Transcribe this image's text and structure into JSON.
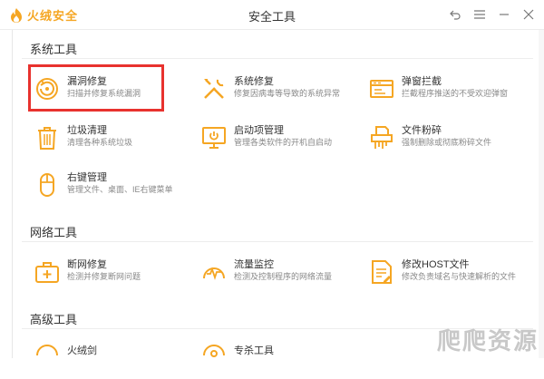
{
  "app": {
    "brand": "火绒安全",
    "window_title": "安全工具",
    "accent": "#f5a623",
    "highlight_color": "#e8322e"
  },
  "window_controls": {
    "back_icon": "back-arrow-icon",
    "menu_icon": "hamburger-menu-icon",
    "minimize_icon": "minimize-icon",
    "close_icon": "close-icon"
  },
  "sections": [
    {
      "title": "系统工具",
      "tools": [
        {
          "name": "漏洞修复",
          "desc": "扫描并修复系统漏洞",
          "icon": "vulnerability-fix-icon"
        },
        {
          "name": "系统修复",
          "desc": "修复因病毒等导致的系统异常",
          "icon": "system-repair-tools-icon"
        },
        {
          "name": "弹窗拦截",
          "desc": "拦截程序推送的不受欢迎弹窗",
          "icon": "popup-window-icon"
        },
        {
          "name": "垃圾清理",
          "desc": "清理各种系统垃圾",
          "icon": "trash-bin-icon"
        },
        {
          "name": "启动项管理",
          "desc": "管理各类软件的开机自启动",
          "icon": "startup-monitor-icon"
        },
        {
          "name": "文件粉碎",
          "desc": "强制删除或彻底粉碎文件",
          "icon": "file-shredder-icon"
        },
        {
          "name": "右键管理",
          "desc": "管理文件、桌面、IE右键菜单",
          "icon": "mouse-icon"
        }
      ]
    },
    {
      "title": "网络工具",
      "tools": [
        {
          "name": "断网修复",
          "desc": "检测并修复断网问题",
          "icon": "network-repair-kit-icon"
        },
        {
          "name": "流量监控",
          "desc": "检测及控制程序的网络流量",
          "icon": "traffic-gauge-icon"
        },
        {
          "name": "修改HOST文件",
          "desc": "修改负责域名与快速解析的文件",
          "icon": "host-file-edit-icon"
        }
      ]
    },
    {
      "title": "高级工具",
      "tools": [
        {
          "name": "火绒剑",
          "desc": "",
          "icon": "sword-icon"
        },
        {
          "name": "专杀工具",
          "desc": "",
          "icon": "special-kill-icon"
        }
      ]
    }
  ],
  "watermark": "爬爬资源"
}
